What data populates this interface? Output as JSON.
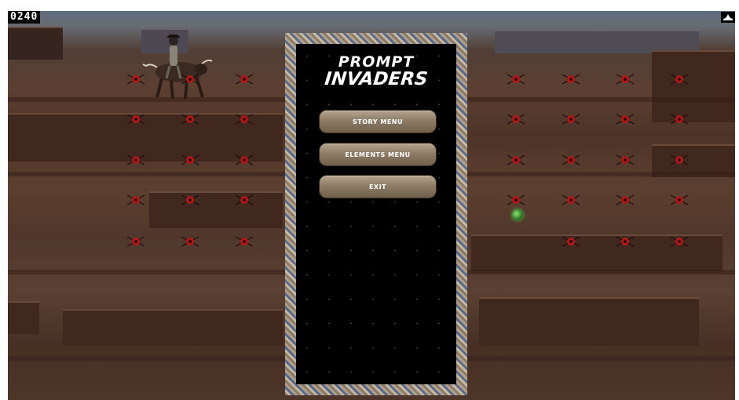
{
  "hud": {
    "score": "0240",
    "lives_icon": "ship-icon"
  },
  "menu": {
    "logo_line1": "PROMPT",
    "logo_line2": "INVADERS",
    "buttons": [
      {
        "label": "STORY MENU"
      },
      {
        "label": "ELEMENTS MENU"
      },
      {
        "label": "EXIT"
      }
    ]
  },
  "colors": {
    "panel_bg": "#000000",
    "button_stone": "#8e7c66",
    "invader_red": "#b01818",
    "orb_green": "#5fcf4a"
  }
}
